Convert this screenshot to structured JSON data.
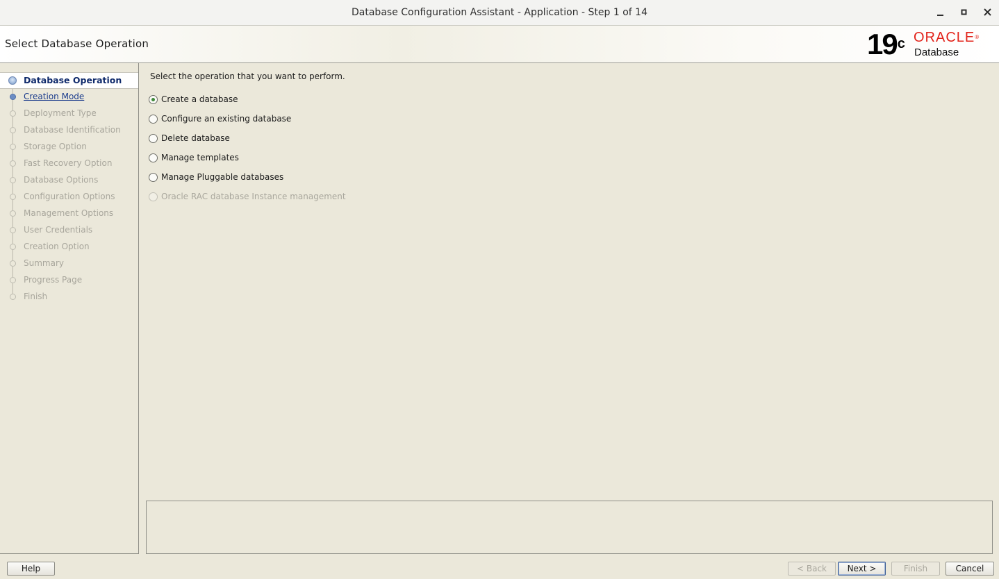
{
  "window": {
    "title": "Database Configuration Assistant - Application - Step 1 of 14",
    "controls": [
      "minimize-icon",
      "maximize-icon",
      "close-icon"
    ]
  },
  "header": {
    "page_title": "Select Database Operation",
    "logo": {
      "version": "19",
      "version_sup": "c",
      "brand": "ORACLE",
      "brand_mark": "®",
      "product": "Database"
    }
  },
  "sidebar": {
    "steps": [
      {
        "label": "Database Operation",
        "state": "current"
      },
      {
        "label": "Creation Mode",
        "state": "link"
      },
      {
        "label": "Deployment Type",
        "state": "disabled"
      },
      {
        "label": "Database Identification",
        "state": "disabled"
      },
      {
        "label": "Storage Option",
        "state": "disabled"
      },
      {
        "label": "Fast Recovery Option",
        "state": "disabled"
      },
      {
        "label": "Database Options",
        "state": "disabled"
      },
      {
        "label": "Configuration Options",
        "state": "disabled"
      },
      {
        "label": "Management Options",
        "state": "disabled"
      },
      {
        "label": "User Credentials",
        "state": "disabled"
      },
      {
        "label": "Creation Option",
        "state": "disabled"
      },
      {
        "label": "Summary",
        "state": "disabled"
      },
      {
        "label": "Progress Page",
        "state": "disabled"
      },
      {
        "label": "Finish",
        "state": "disabled"
      }
    ]
  },
  "main": {
    "prompt": "Select the operation that you want to perform.",
    "options": [
      {
        "label": "Create a database",
        "selected": true,
        "enabled": true
      },
      {
        "label": "Configure an existing database",
        "selected": false,
        "enabled": true
      },
      {
        "label": "Delete database",
        "selected": false,
        "enabled": true
      },
      {
        "label": "Manage templates",
        "selected": false,
        "enabled": true
      },
      {
        "label": "Manage Pluggable databases",
        "selected": false,
        "enabled": true
      },
      {
        "label": "Oracle RAC database Instance management",
        "selected": false,
        "enabled": false
      }
    ]
  },
  "footer": {
    "help": "Help",
    "back": "< Back",
    "next": "Next >",
    "finish": "Finish",
    "cancel": "Cancel"
  },
  "colors": {
    "brand_red": "#e2231a",
    "background": "#ebe8da",
    "current_step": "#0f2a6b",
    "selected_radio": "#3f8a3a"
  }
}
